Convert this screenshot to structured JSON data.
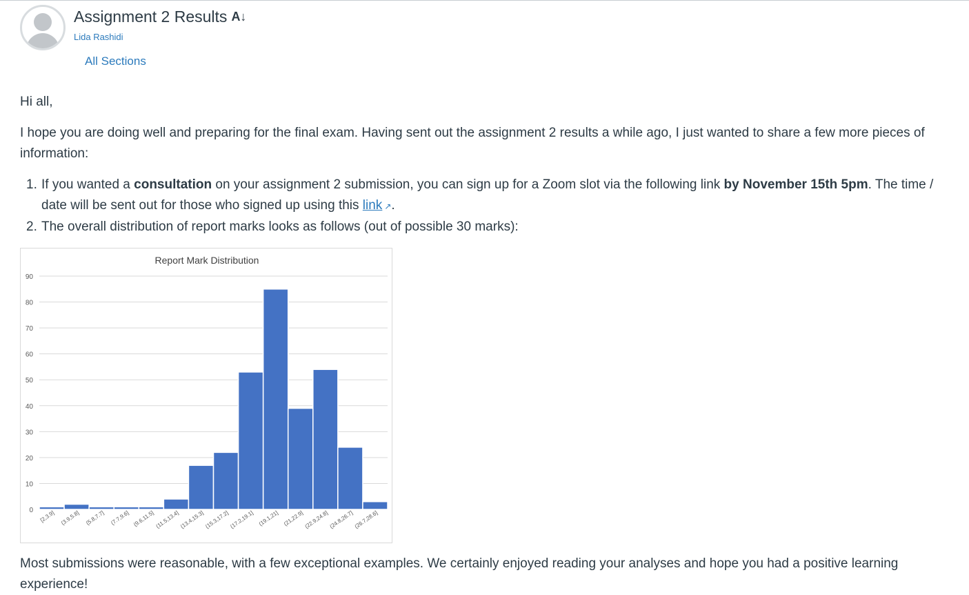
{
  "post": {
    "title": "Assignment 2 Results",
    "author": "Lida Rashidi",
    "sections": "All Sections",
    "greeting": "Hi all,",
    "intro": "I hope you are doing well and preparing for the final exam. Having sent out the assignment 2 results a while ago, I just wanted to share a few more pieces of information:",
    "item1": {
      "number": "1.",
      "text_a": "If you wanted a ",
      "bold_a": "consultation",
      "text_b": " on your assignment 2 submission, you can sign up for a Zoom slot via the following link ",
      "bold_b": "by November 15th 5pm",
      "text_c": ". The time / date will be sent out for those who signed up using this ",
      "link": "link",
      "text_d": "."
    },
    "item2": {
      "number": "2.",
      "text": "The overall distribution of report marks looks as follows (out of possible 30 marks):"
    },
    "outro": "Most submissions were reasonable, with a few exceptional examples. We certainly enjoyed reading your analyses and hope you had a positive learning experience!"
  },
  "icons": {
    "title_icon": "ab-download-icon",
    "link_icon": "external-link-icon"
  },
  "chart_data": {
    "type": "bar",
    "title": "Report Mark Distribution",
    "categories": [
      "[2,3.9]",
      "(3.9,5.8]",
      "(5.8,7.7]",
      "(7.7,9.6]",
      "(9.6,11.5]",
      "(11.5,13.4]",
      "(13.4,15.3]",
      "(15.3,17.2]",
      "(17.2,19.1]",
      "(19.1,21]",
      "(21,22.9]",
      "(22.9,24.8]",
      "(24.8,26.7]",
      "(26.7,28.6]"
    ],
    "values": [
      1,
      2,
      1,
      1,
      1,
      4,
      17,
      22,
      53,
      85,
      39,
      54,
      24,
      3
    ],
    "ylim": [
      0,
      90
    ],
    "yticks": [
      0,
      10,
      20,
      30,
      40,
      50,
      60,
      70,
      80,
      90
    ],
    "grid": true,
    "bar_color": "#4472c4"
  }
}
